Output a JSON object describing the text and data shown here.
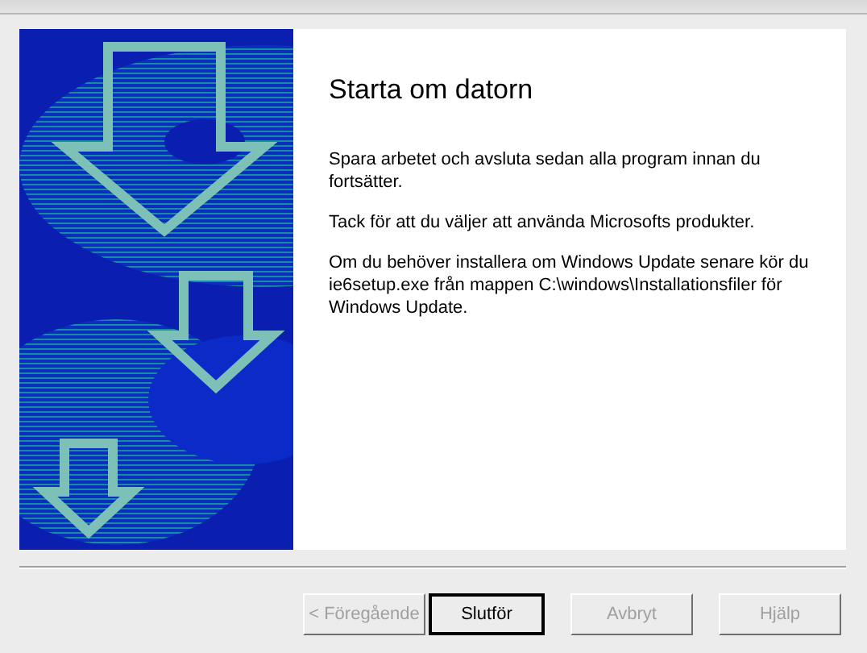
{
  "page": {
    "title": "Starta om datorn",
    "paragraphs": [
      "Spara arbetet och avsluta sedan alla program innan du fortsätter.",
      "Tack för att du väljer att använda Microsofts produkter.",
      "Om du behöver installera om Windows Update senare kör du ie6setup.exe från mappen C:\\windows\\Installationsfiler för Windows Update."
    ]
  },
  "buttons": [
    {
      "label": "< Föregående",
      "disabled": true,
      "default": false
    },
    {
      "label": "Slutför",
      "disabled": false,
      "default": true
    },
    {
      "label": "Avbryt",
      "disabled": true,
      "default": false
    },
    {
      "label": "Hjälp",
      "disabled": true,
      "default": false
    }
  ]
}
